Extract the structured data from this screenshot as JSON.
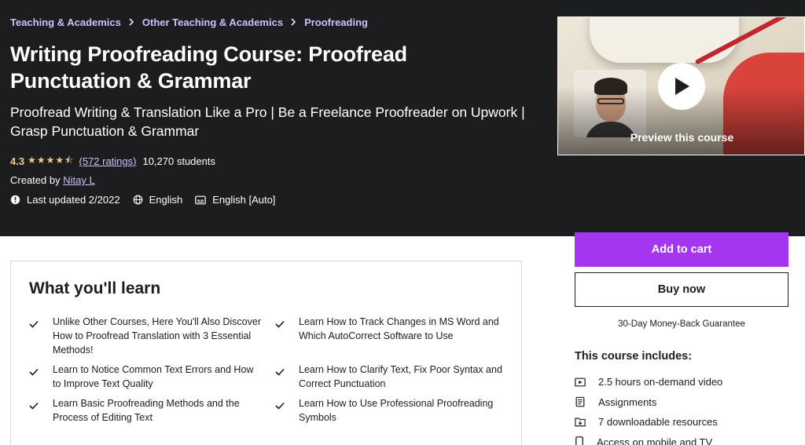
{
  "breadcrumb": [
    "Teaching & Academics",
    "Other Teaching & Academics",
    "Proofreading"
  ],
  "course": {
    "title": "Writing Proofreading Course: Proofread Punctuation & Grammar",
    "subtitle": "Proofread Writing & Translation Like a Pro | Be a Freelance Proofreader on Upwork | Grasp Punctuation & Grammar",
    "rating": "4.3",
    "rating_value": 4.3,
    "stars": "★★★★⯪",
    "ratings_count": "(572 ratings)",
    "students": "10,270 students",
    "created_by_label": "Created by",
    "instructor": "Nitay L",
    "last_updated": "Last updated 2/2022",
    "language": "English",
    "captions": "English [Auto]"
  },
  "preview": {
    "label": "Preview this course"
  },
  "purchase": {
    "add_to_cart": "Add to cart",
    "buy_now": "Buy now",
    "guarantee": "30-Day Money-Back Guarantee"
  },
  "includes": {
    "title": "This course includes:",
    "items": [
      {
        "icon": "video-icon",
        "label": "2.5 hours on-demand video"
      },
      {
        "icon": "assignment-icon",
        "label": "Assignments"
      },
      {
        "icon": "download-icon",
        "label": "7 downloadable resources"
      },
      {
        "icon": "mobile-icon",
        "label": "Access on mobile and TV"
      }
    ]
  },
  "learn": {
    "title": "What you'll learn",
    "items": [
      "Unlike Other Courses, Here You'll Also Discover How to Proofread Translation with 3 Essential Methods!",
      "Learn How to Track Changes in MS Word and Which AutoCorrect Software to Use",
      "Learn to Notice Common Text Errors and How to Improve Text Quality",
      "Learn How to Clarify Text, Fix Poor Syntax and Correct Punctuation",
      "Learn Basic Proofreading Methods and the Process of Editing Text",
      "Learn How to Use Professional Proofreading Symbols"
    ]
  },
  "colors": {
    "hero_bg": "#1c1d1f",
    "accent": "#a435f0",
    "link": "#cec0fc",
    "star": "#f3ca8c"
  }
}
